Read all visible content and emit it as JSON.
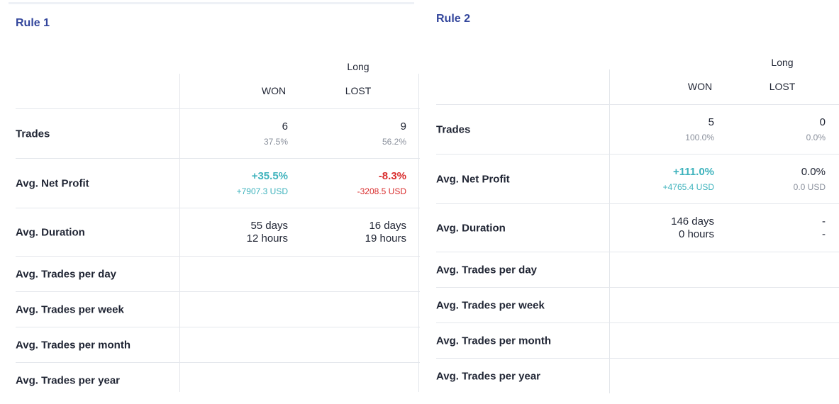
{
  "colors": {
    "title": "#33469c",
    "positive": "#3fb3bd",
    "negative": "#d92d2d",
    "muted": "#8a909c",
    "text": "#1f2433"
  },
  "rule1": {
    "title": "Rule 1",
    "group": "Long",
    "col_won": "WON",
    "col_lost": "LOST",
    "row_labels": [
      "Trades",
      "Avg. Net Profit",
      "Avg. Duration",
      "Avg. Trades per day",
      "Avg. Trades per week",
      "Avg. Trades per month",
      "Avg. Trades per year"
    ],
    "trades": {
      "won_count": "6",
      "won_pct": "37.5%",
      "lost_count": "9",
      "lost_pct": "56.2%"
    },
    "profit": {
      "won_pct": "+35.5%",
      "won_usd": "+7907.3 USD",
      "lost_pct": "-8.3%",
      "lost_usd": "-3208.5 USD"
    },
    "duration": {
      "won_days": "55 days",
      "won_hours": "12 hours",
      "lost_days": "16 days",
      "lost_hours": "19 hours"
    }
  },
  "rule2": {
    "title": "Rule 2",
    "group": "Long",
    "col_won": "WON",
    "col_lost": "LOST",
    "row_labels": [
      "Trades",
      "Avg. Net Profit",
      "Avg. Duration",
      "Avg. Trades per day",
      "Avg. Trades per week",
      "Avg. Trades per month",
      "Avg. Trades per year"
    ],
    "trades": {
      "won_count": "5",
      "won_pct": "100.0%",
      "lost_count": "0",
      "lost_pct": "0.0%"
    },
    "profit": {
      "won_pct": "+111.0%",
      "won_usd": "+4765.4 USD",
      "lost_pct": "0.0%",
      "lost_usd": "0.0 USD"
    },
    "duration": {
      "won_days": "146 days",
      "won_hours": "0 hours",
      "lost_days": "-",
      "lost_hours": "-"
    }
  }
}
